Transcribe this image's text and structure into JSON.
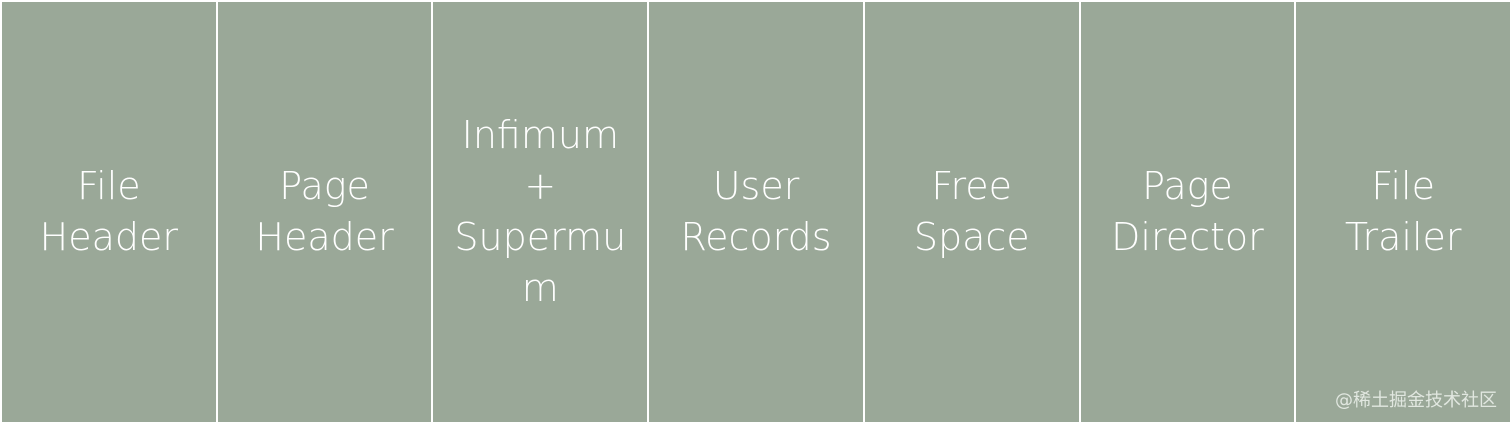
{
  "diagram": {
    "blocks": [
      {
        "label": "File\nHeader"
      },
      {
        "label": "Page\nHeader"
      },
      {
        "label": "Infimum\n+\nSupermu\nm"
      },
      {
        "label": "User\nRecords"
      },
      {
        "label": "Free\nSpace"
      },
      {
        "label": "Page\nDirector"
      },
      {
        "label": "File\nTrailer"
      }
    ]
  },
  "watermark": {
    "text": "@稀土掘金技术社区"
  },
  "colors": {
    "block_fill": "#9aa898",
    "divider": "#ffffff",
    "text": "#ffffff"
  }
}
